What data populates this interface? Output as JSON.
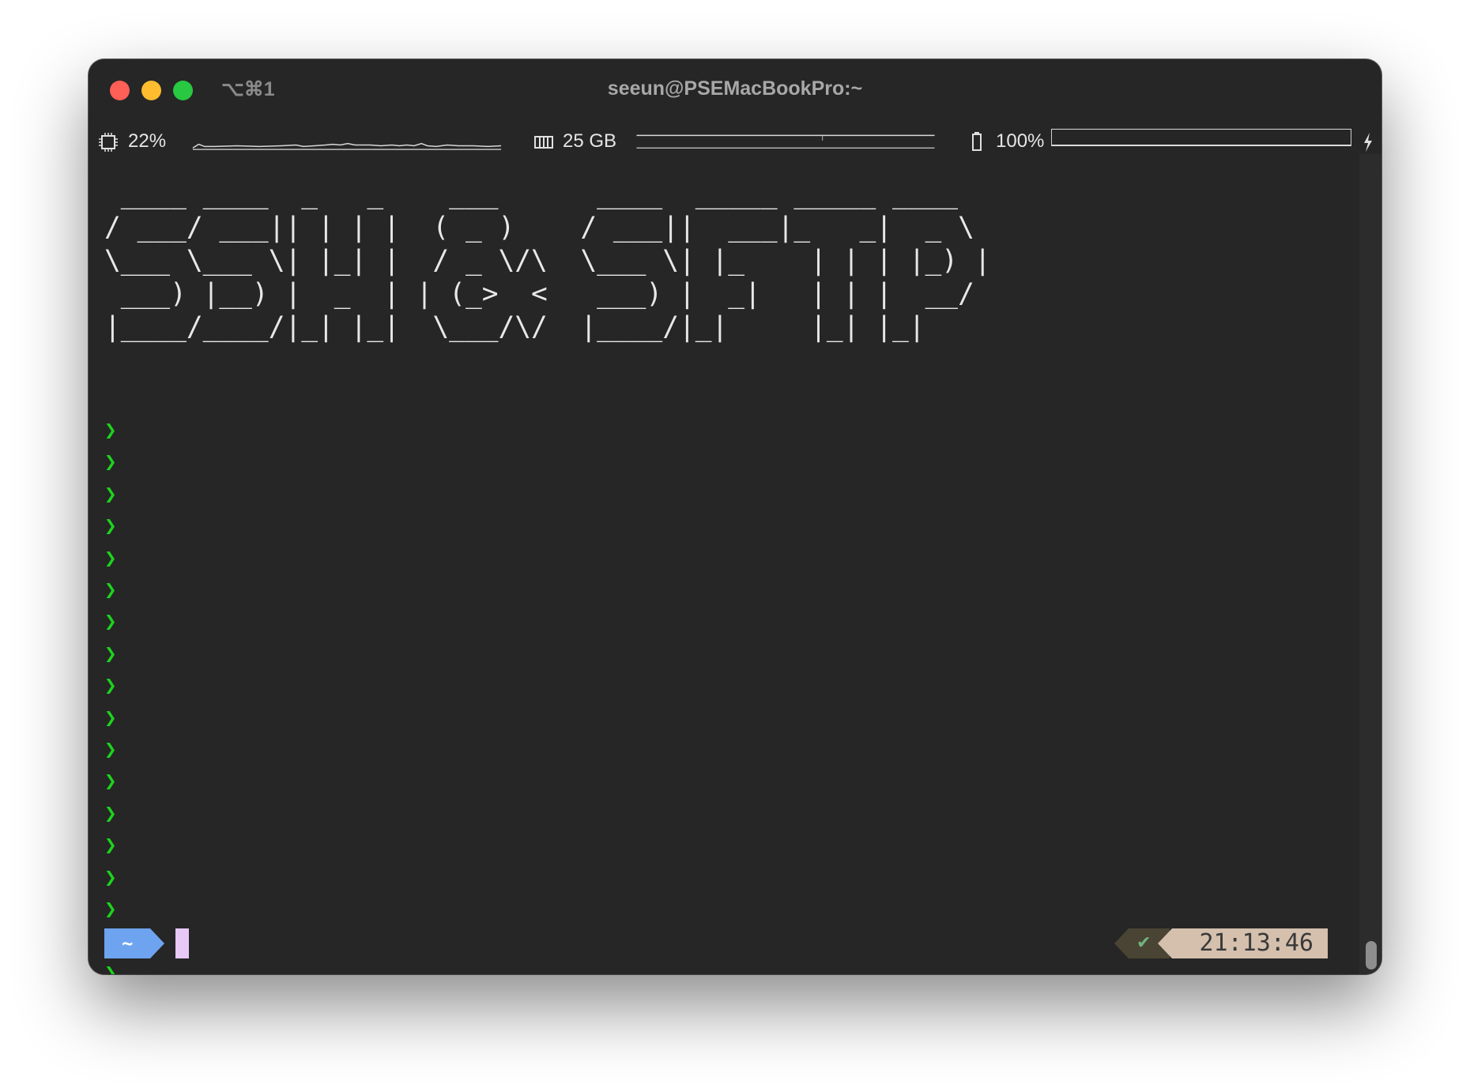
{
  "window": {
    "title": "seeun@PSEMacBookPro:~",
    "shortcut": "⌥⌘1"
  },
  "statusbar": {
    "cpu": {
      "icon": "cpu-chip-icon",
      "value": "22%"
    },
    "memory": {
      "icon": "memory-icon",
      "value": "25 GB"
    },
    "battery": {
      "icon": "battery-icon",
      "value": "100%",
      "level": 1.0,
      "charging_icon": "lightning-bolt-icon"
    }
  },
  "terminal": {
    "banner_lines": [
      " ____ ____  _   _    ___      ____  _____ _____ ____  ",
      "/ ___/ ___|| | | |  ( _ )    / ___||  ___|_   _|  _ \\ ",
      "\\___ \\___ \\| |_| |  / _ \\/\\  \\___ \\| |_    | | | |_) |",
      " ___) |__) |  _  | | (_>  <   ___) |  _|   | | |  __/ ",
      "|____/____/|_| |_|  \\___/\\/  |____/|_|     |_| |_|    "
    ],
    "prompt_symbol": "❯",
    "prompt_count": 18,
    "directory": "~",
    "status_check": "✔",
    "time": "21:13:46"
  },
  "colors": {
    "background": "#262626",
    "prompt_green": "#1dd21d",
    "dir_segment": "#6ea3ef",
    "time_segment": "#d4c0ad",
    "status_segment": "#4a4434",
    "cursor": "#e7c8f6"
  }
}
